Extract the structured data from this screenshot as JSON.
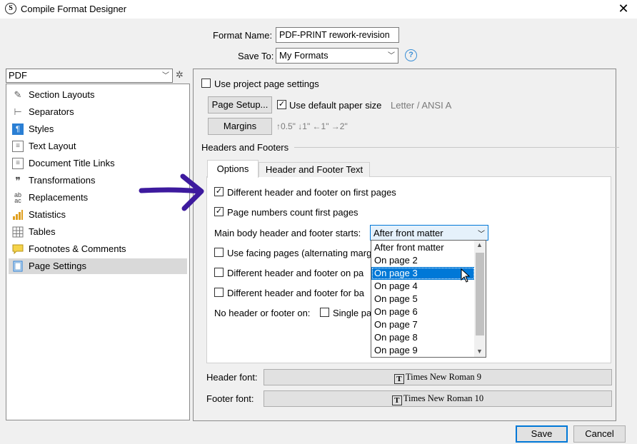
{
  "window": {
    "title": "Compile Format Designer",
    "close_glyph": "✕",
    "icon_letter": "S"
  },
  "top_form": {
    "format_name_label": "Format Name:",
    "format_name_value": "PDF-PRINT rework-revision",
    "save_to_label": "Save To:",
    "save_to_value": "My Formats",
    "help_glyph": "?"
  },
  "left_panel": {
    "format_select_value": "PDF",
    "items": [
      {
        "label": "Section Layouts",
        "icon": "brush-icon",
        "glyph": "🖌"
      },
      {
        "label": "Separators",
        "icon": "separator-icon",
        "glyph": "⊢"
      },
      {
        "label": "Styles",
        "icon": "styles-icon",
        "glyph": "¶"
      },
      {
        "label": "Text Layout",
        "icon": "text-layout-icon",
        "glyph": "▤"
      },
      {
        "label": "Document Title Links",
        "icon": "document-icon",
        "glyph": "▯"
      },
      {
        "label": "Transformations",
        "icon": "quotes-icon",
        "glyph": "❞"
      },
      {
        "label": "Replacements",
        "icon": "replace-icon",
        "glyph": "ab"
      },
      {
        "label": "Statistics",
        "icon": "bar-chart-icon",
        "glyph": "▁▃▅"
      },
      {
        "label": "Tables",
        "icon": "table-icon",
        "glyph": "▦"
      },
      {
        "label": "Footnotes & Comments",
        "icon": "comment-icon",
        "glyph": "▭"
      },
      {
        "label": "Page Settings",
        "icon": "page-settings-icon",
        "glyph": "▯"
      }
    ],
    "selected_index": 10
  },
  "page_settings": {
    "use_project_page_settings": "Use project page settings",
    "page_setup_button": "Page Setup...",
    "use_default_paper_size": "Use default paper size",
    "paper_size_value": "Letter / ANSI A",
    "margins_button": "Margins",
    "margins_value": "↑0.5\" ↓1\" ←1\" →2\""
  },
  "headers_footers": {
    "group_title": "Headers and Footers",
    "tabs": [
      {
        "label": "Options",
        "active": true
      },
      {
        "label": "Header and Footer Text",
        "active": false
      }
    ],
    "diff_first_pages": "Different header and footer on first pages",
    "page_numbers_count": "Page numbers count first pages",
    "main_body_starts_label": "Main body header and footer starts:",
    "main_body_starts_value": "After front matter",
    "facing_pages": "Use facing pages (alternating marg",
    "diff_on_page": "Different header and footer on pa",
    "diff_for_back": "Different header and footer for ba",
    "no_header_label": "No header or footer on:",
    "single_page": "Single pa",
    "dropdown_options": [
      "After front matter",
      "On page 2",
      "On page 3",
      "On page 4",
      "On page 5",
      "On page 6",
      "On page 7",
      "On page 8",
      "On page 9"
    ],
    "highlighted_option": "On page 3"
  },
  "fonts": {
    "header_label": "Header font:",
    "header_value": "Times New Roman 9",
    "footer_label": "Footer font:",
    "footer_value": "Times New Roman 10"
  },
  "buttons": {
    "save": "Save",
    "cancel": "Cancel"
  },
  "colors": {
    "accent": "#0078d7",
    "annotation_arrow": "#3d1a9e"
  }
}
